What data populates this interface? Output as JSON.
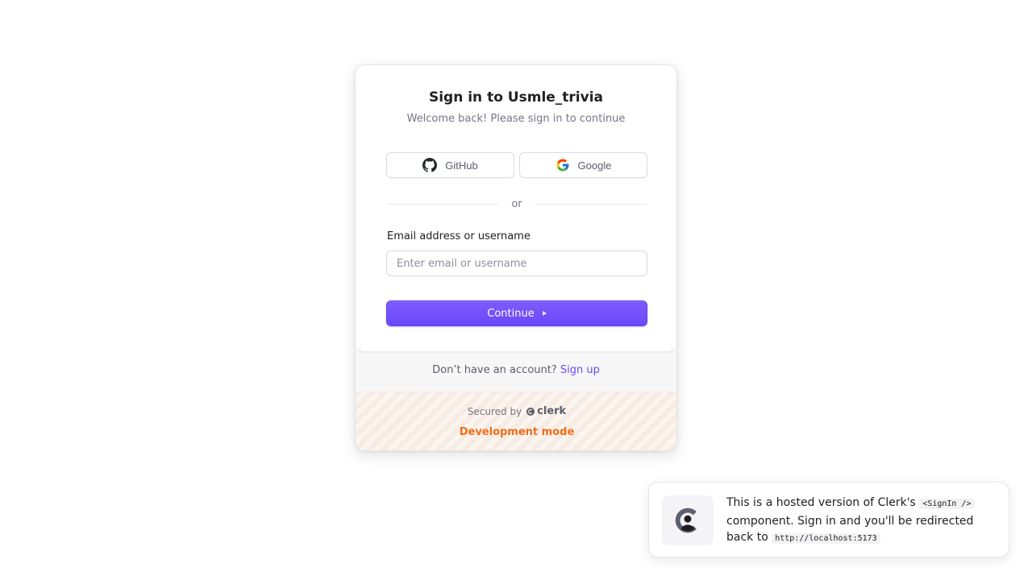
{
  "signin": {
    "title": "Sign in to Usmle_trivia",
    "subtitle": "Welcome back! Please sign in to continue",
    "github_label": "GitHub",
    "google_label": "Google",
    "divider_text": "or",
    "email_label": "Email address or username",
    "email_placeholder": "Enter email or username",
    "email_value": "",
    "continue_label": "Continue",
    "no_account_text": "Don’t have an account?",
    "signup_link": "Sign up",
    "secured_by": "Secured by",
    "brand_name": "clerk",
    "dev_mode": "Development mode"
  },
  "toast": {
    "text_1": "This is a hosted version of Clerk's",
    "code_1": "<SignIn />",
    "text_2": "component. Sign in and you'll be redirected back to",
    "code_2": "http://localhost:5173"
  },
  "colors": {
    "accent": "#6c47ff",
    "dev_mode": "#f36b16",
    "title": "#212126",
    "muted": "#747686"
  },
  "icons": [
    "github-icon",
    "google-icon",
    "continue-caret-icon",
    "clerk-logo-icon"
  ]
}
